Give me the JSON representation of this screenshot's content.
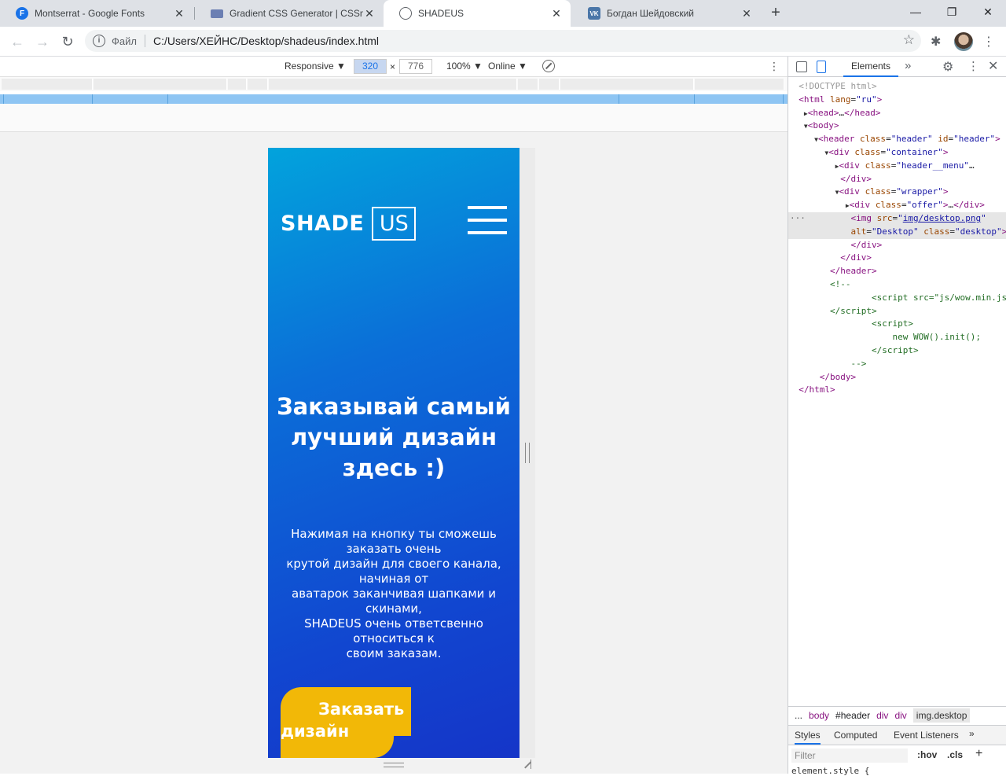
{
  "browser": {
    "tabs": [
      {
        "title": "Montserrat - Google Fonts",
        "favicon": "F"
      },
      {
        "title": "Gradient CSS Generator | CSSmat",
        "favicon": ""
      },
      {
        "title": "SHADEUS",
        "favicon": ""
      },
      {
        "title": "Богдан Шейдовский",
        "favicon": "VK"
      }
    ],
    "new_tab": "+",
    "window": {
      "minimize": "—",
      "restore": "❐",
      "close": "✕"
    },
    "file_label": "Файл",
    "url": "C:/Users/ХЕЙНС/Desktop/shadeus/index.html"
  },
  "device_toolbar": {
    "mode": "Responsive ▼",
    "width": "320",
    "x": "×",
    "height": "776",
    "zoom": "100% ▼",
    "network": "Online ▼"
  },
  "page": {
    "logo_shade": "SHADE",
    "logo_us": "US",
    "headline": "Заказывай самый лучший дизайн здесь :)",
    "sub": [
      "Нажимая на кнопку ты сможешь",
      "заказать очень",
      "крутой дизайн для своего канала,",
      "начиная от",
      "аватарок заканчивая шапками и",
      "скинами,",
      "SHADEUS очень ответсвенно",
      "относиться к",
      "своим заказам."
    ],
    "cta_line1": "Заказать",
    "cta_line2": "дизайн"
  },
  "devtools": {
    "panel_tab": "Elements",
    "breadcrumbs": [
      "...",
      "body",
      "#header",
      "div",
      "div",
      "img.desktop"
    ],
    "style_tabs": [
      "Styles",
      "Computed",
      "Event Listeners"
    ],
    "filter_placeholder": "Filter",
    "hov": ":hov",
    "cls": ".cls",
    "element_style": "element.style {"
  },
  "colors": {
    "gradient_start": "#02a3dc",
    "gradient_end": "#1535c8",
    "cta": "#f2b807",
    "accent": "#1a73e8"
  }
}
